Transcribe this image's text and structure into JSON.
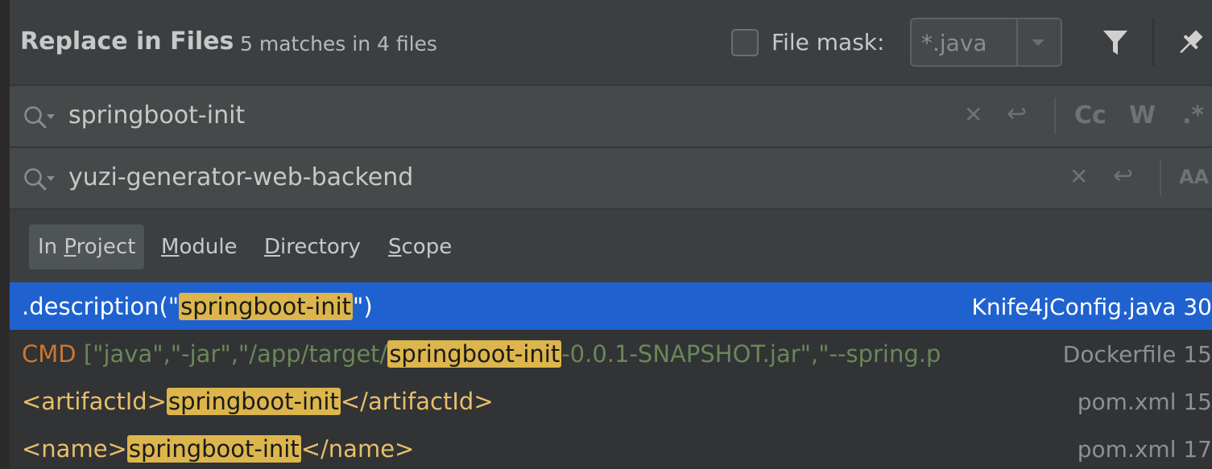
{
  "header": {
    "title": "Replace in Files",
    "match_summary": "5 matches in 4 files",
    "file_mask_label": "File mask:",
    "file_mask_value": "*.java"
  },
  "search": {
    "query": "springboot-init",
    "toggle_case": "Cc",
    "toggle_words": "W",
    "toggle_regex": ".*"
  },
  "replace": {
    "value": "yuzi-generator-web-backend",
    "toggle_preserve_case": "AA"
  },
  "scope_tabs": [
    {
      "label": "In Project",
      "mnemonic": "P"
    },
    {
      "label": "Module",
      "mnemonic": "M"
    },
    {
      "label": "Directory",
      "mnemonic": "D"
    },
    {
      "label": "Scope",
      "mnemonic": "S"
    }
  ],
  "results": [
    {
      "pre": ".description(\"",
      "match": "springboot-init",
      "post": "\")",
      "file": "Knife4jConfig.java 30"
    },
    {
      "keyword": "CMD",
      "pre": " [\"java\",\"-jar\",\"/app/target/",
      "match": "springboot-init",
      "post": "-0.0.1-SNAPSHOT.jar\",\"--spring.p",
      "file": "Dockerfile 15"
    },
    {
      "pre": "<artifactId>",
      "match": "springboot-init",
      "post": "</artifactId>",
      "file": "pom.xml 15"
    },
    {
      "pre": "<name>",
      "match": "springboot-init",
      "post": "</name>",
      "file": "pom.xml 17"
    }
  ],
  "colors": {
    "selected_row": "#1f62cf",
    "match_highlight": "#dcb54c",
    "panel_bg": "#3c3f41"
  },
  "icons": [
    "checkbox-icon",
    "chevron-down-icon",
    "filter-icon",
    "pin-icon",
    "search-history-icon",
    "clear-icon",
    "newline-icon"
  ]
}
